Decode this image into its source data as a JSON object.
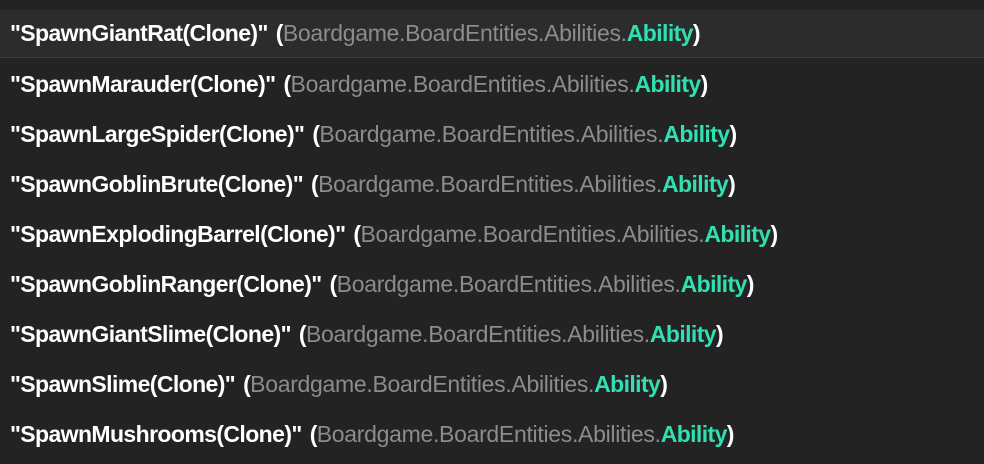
{
  "rows": [
    {
      "name": "\"SpawnGiantRat(Clone)\"",
      "namespace": "Boardgame.BoardEntities.Abilities.",
      "type": "Ability"
    },
    {
      "name": "\"SpawnMarauder(Clone)\"",
      "namespace": "Boardgame.BoardEntities.Abilities.",
      "type": "Ability"
    },
    {
      "name": "\"SpawnLargeSpider(Clone)\"",
      "namespace": "Boardgame.BoardEntities.Abilities.",
      "type": "Ability"
    },
    {
      "name": "\"SpawnGoblinBrute(Clone)\"",
      "namespace": "Boardgame.BoardEntities.Abilities.",
      "type": "Ability"
    },
    {
      "name": "\"SpawnExplodingBarrel(Clone)\"",
      "namespace": "Boardgame.BoardEntities.Abilities.",
      "type": "Ability"
    },
    {
      "name": "\"SpawnGoblinRanger(Clone)\"",
      "namespace": "Boardgame.BoardEntities.Abilities.",
      "type": "Ability"
    },
    {
      "name": "\"SpawnGiantSlime(Clone)\"",
      "namespace": "Boardgame.BoardEntities.Abilities.",
      "type": "Ability"
    },
    {
      "name": "\"SpawnSlime(Clone)\"",
      "namespace": "Boardgame.BoardEntities.Abilities.",
      "type": "Ability"
    },
    {
      "name": "\"SpawnMushrooms(Clone)\"",
      "namespace": "Boardgame.BoardEntities.Abilities.",
      "type": "Ability"
    }
  ],
  "colors": {
    "background": "#232323",
    "name": "#ffffff",
    "namespace": "#8c8c8c",
    "type": "#2fe0b0"
  }
}
